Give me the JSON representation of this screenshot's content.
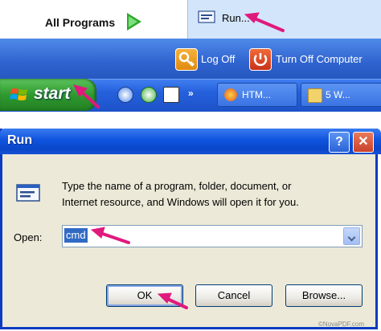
{
  "start_menu": {
    "all_programs_label": "All Programs",
    "run_label": "Run...",
    "log_off_label": "Log Off",
    "turn_off_label": "Turn Off Computer"
  },
  "taskbar": {
    "start_label": "start",
    "chevron": "»",
    "tasks": [
      {
        "label": "HTM...",
        "icon": "firefox-icon"
      },
      {
        "label": "5 W...",
        "icon": "folder-icon"
      }
    ]
  },
  "run_dialog": {
    "title": "Run",
    "help_glyph": "?",
    "close_glyph": "✕",
    "description_line1": "Type the name of a program, folder, document, or",
    "description_line2": "Internet resource, and Windows will open it for you.",
    "open_label": "Open:",
    "open_value": "cmd",
    "ok_label": "OK",
    "cancel_label": "Cancel",
    "browse_label": "Browse...",
    "copyright": "©NovaPDF.com"
  },
  "colors": {
    "annotation_pink": "#e0197d",
    "xp_blue": "#0a47c9",
    "start_green": "#2f9a2f"
  }
}
